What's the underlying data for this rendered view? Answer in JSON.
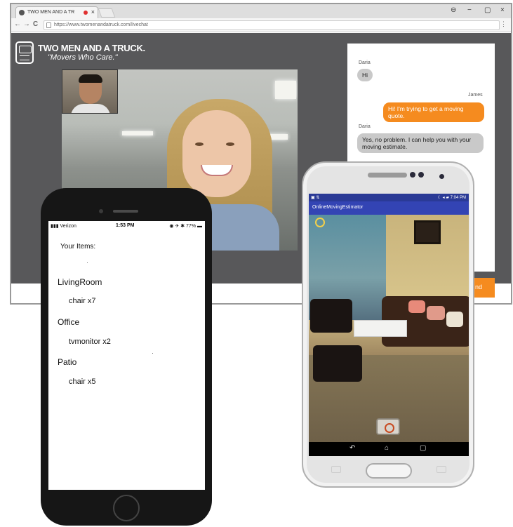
{
  "browser": {
    "tab_title": "TWO MEN AND A TR",
    "tab_close": "×",
    "url": "https://www.twomenandatruck.com/livechat",
    "nav_back": "←",
    "nav_forward": "→",
    "nav_reload": "C",
    "window_controls": {
      "account": "⊖",
      "minimize": "−",
      "restore": "▢",
      "close": "×"
    },
    "menu": "⋮"
  },
  "site": {
    "logo_name": "TWO MEN AND A TRUCK.",
    "logo_tagline": "\"Movers Who Care.\"",
    "chat": [
      {
        "sender": "Daria",
        "text": "Hi",
        "direction": "in"
      },
      {
        "sender": "James",
        "text": "Hi! I'm trying to get a moving quote.",
        "direction": "out"
      },
      {
        "sender": "Daria",
        "text": "Yes, no problem. I can help you with your moving estimate.",
        "direction": "in"
      }
    ],
    "send_label": "nd",
    "accent_color": "#f58b1f"
  },
  "iphone": {
    "carrier": "▮▮▮ Verizon",
    "time": "1:53 PM",
    "battery": "◉ ✈ ✱ 77% ▬",
    "title": "Your Items:",
    "rooms": [
      {
        "name": "LivingRoom",
        "items": [
          "chair x7"
        ]
      },
      {
        "name": "Office",
        "items": [
          "tvmonitor x2"
        ]
      },
      {
        "name": "Patio",
        "items": [
          "chair x5"
        ]
      }
    ]
  },
  "android": {
    "status_left": "▣ ⇅",
    "status_right": "☾ ◂ ▰ 7:04 PM",
    "app_title": "OnlineMovingEstimator",
    "app_bar_color": "#3344b4",
    "nav_back": "↶",
    "nav_home": "⌂",
    "nav_recents": "▢"
  }
}
